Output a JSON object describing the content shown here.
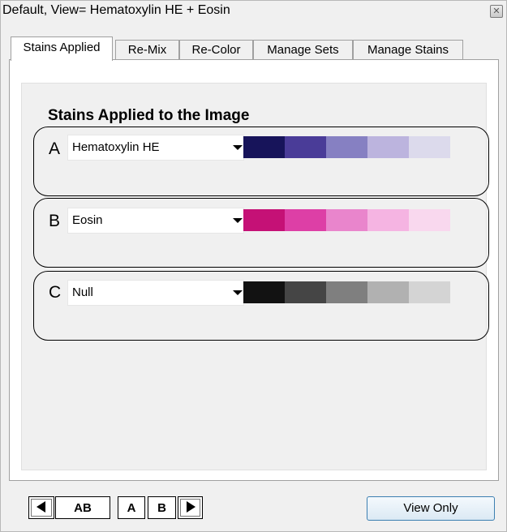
{
  "window": {
    "title": "Default, View= Hematoxylin HE + Eosin",
    "close_icon": "close-x-icon"
  },
  "tabs": [
    {
      "label": "Stains Applied",
      "active": true
    },
    {
      "label": "Re-Mix",
      "active": false
    },
    {
      "label": "Re-Color",
      "active": false
    },
    {
      "label": "Manage Sets",
      "active": false
    },
    {
      "label": "Manage Stains",
      "active": false
    }
  ],
  "panel": {
    "title": "Stains Applied to the Image"
  },
  "stains": [
    {
      "letter": "A",
      "selected": "Hematoxylin HE",
      "swatches": [
        "#17145a",
        "#4a3c98",
        "#8680c2",
        "#bcb4de",
        "#dcdaec"
      ]
    },
    {
      "letter": "B",
      "selected": "Eosin",
      "swatches": [
        "#c51176",
        "#dd3fa6",
        "#e985cc",
        "#f5b4e2",
        "#f9d8ee"
      ]
    },
    {
      "letter": "C",
      "selected": "Null",
      "swatches": [
        "#121212",
        "#454545",
        "#7f7f7f",
        "#b1b1b1",
        "#d4d4d4"
      ]
    }
  ],
  "footer": {
    "prev_icon": "triangle-left-icon",
    "ab_label": "AB",
    "a_label": "A",
    "b_label": "B",
    "next_icon": "triangle-right-icon",
    "view_only_label": "View Only"
  }
}
